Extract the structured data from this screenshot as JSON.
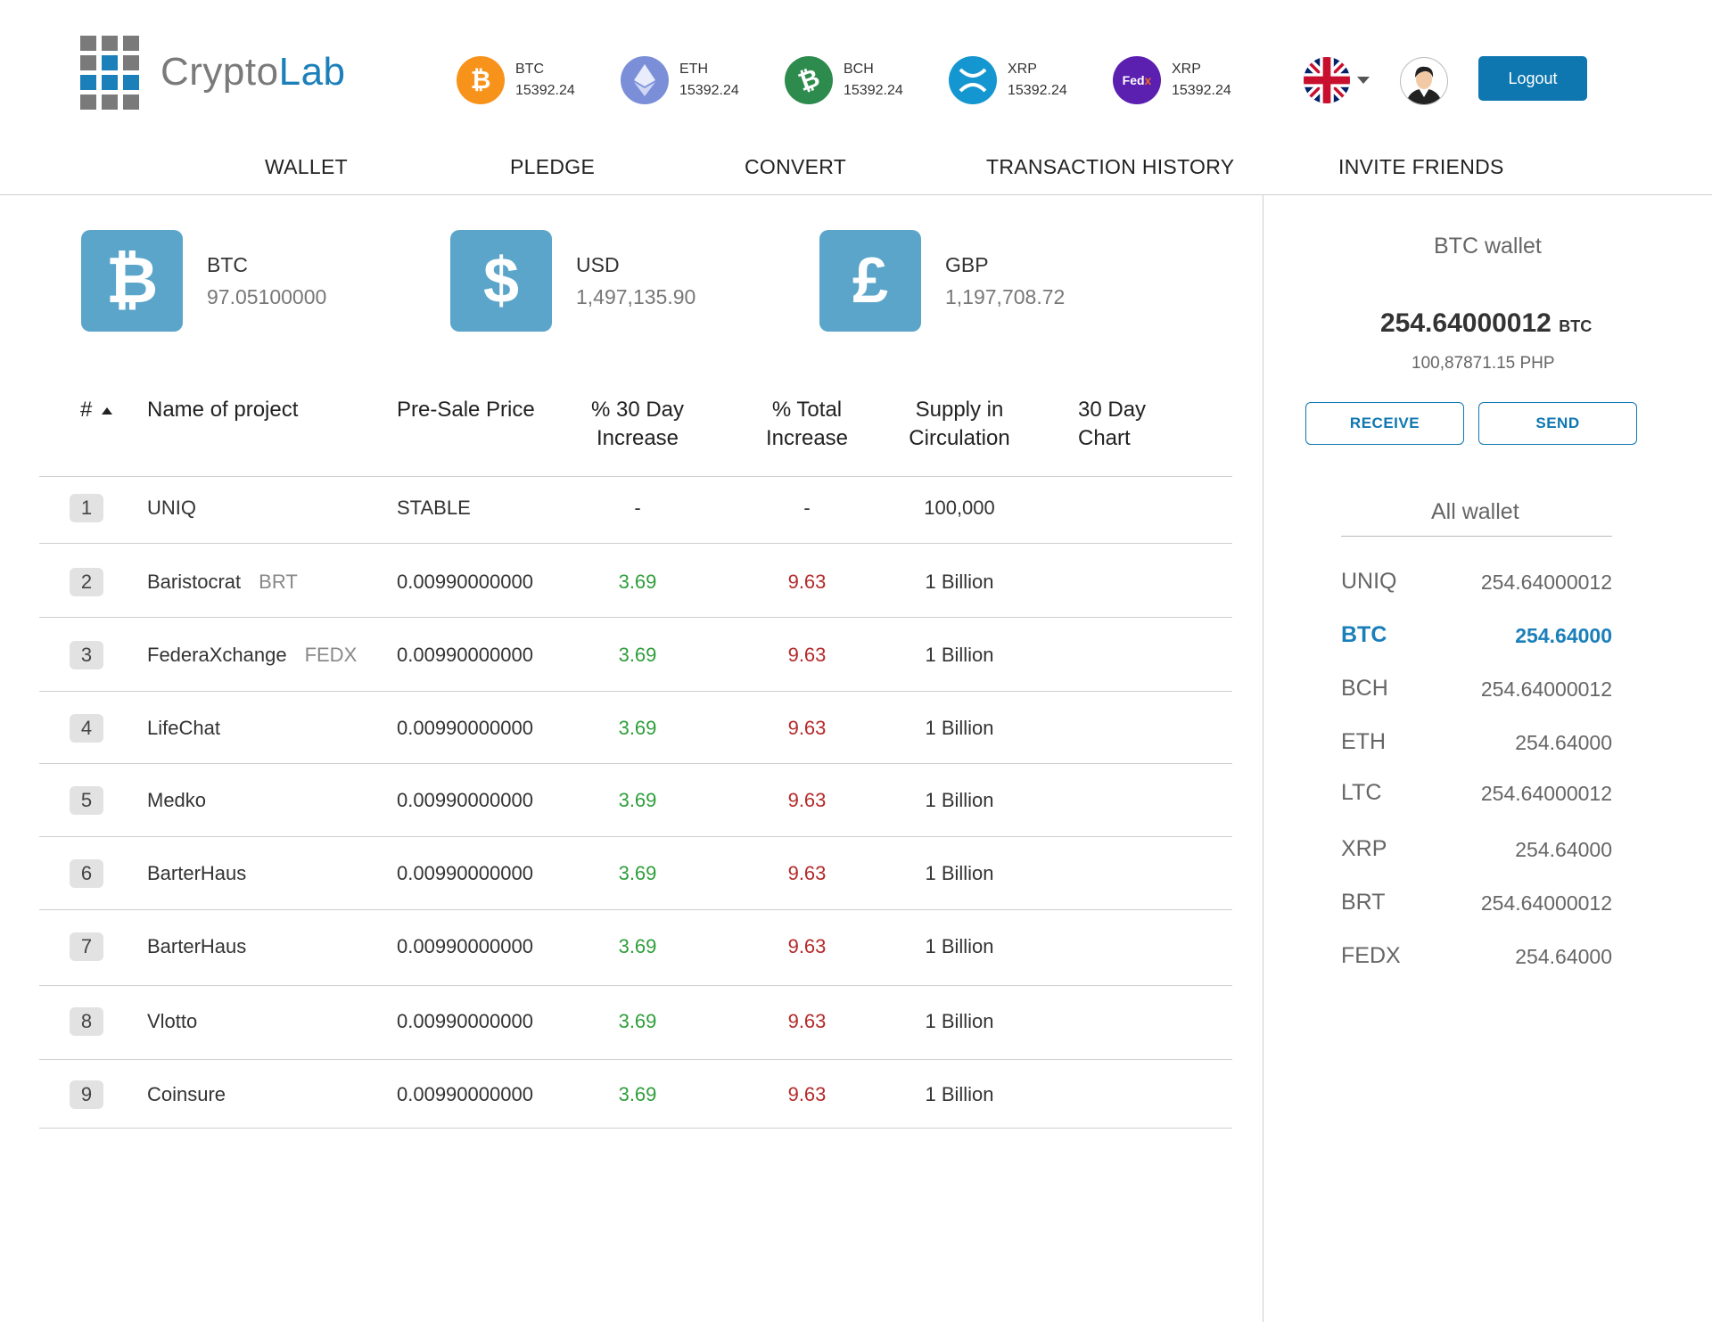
{
  "brand": {
    "part1": "Crypto",
    "part2": "Lab"
  },
  "ticker": [
    {
      "symbol": "BTC",
      "price": "15392.24",
      "icon": "bitcoin-icon",
      "color": "#f7931a",
      "glyph": "₿"
    },
    {
      "symbol": "ETH",
      "price": "15392.24",
      "icon": "ethereum-icon",
      "color": "#7b8fd8",
      "glyph": "◆"
    },
    {
      "symbol": "BCH",
      "price": "15392.24",
      "icon": "bitcoin-cash-icon",
      "color": "#2e8b4e",
      "glyph": "₿"
    },
    {
      "symbol": "XRP",
      "price": "15392.24",
      "icon": "ripple-icon",
      "color": "#1496d0",
      "glyph": "✕"
    },
    {
      "symbol": "XRP",
      "price": "15392.24",
      "icon": "fedx-icon",
      "color": "#5b20b0",
      "glyph": "Fed"
    }
  ],
  "header": {
    "logout": "Logout"
  },
  "nav": [
    "WALLET",
    "PLEDGE",
    "CONVERT",
    "TRANSACTION HISTORY",
    "INVITE FRIENDS"
  ],
  "balances": [
    {
      "code": "BTC",
      "amount": "97.05100000",
      "glyph": "₿"
    },
    {
      "code": "USD",
      "amount": "1,497,135.90",
      "glyph": "$"
    },
    {
      "code": "GBP",
      "amount": "1,197,708.72",
      "glyph": "£"
    }
  ],
  "table": {
    "headers": {
      "num": "#",
      "name": "Name of project",
      "price": "Pre-Sale Price",
      "d30_1": "% 30 Day",
      "d30_2": "Increase",
      "total_1": "% Total",
      "total_2": "Increase",
      "supply_1": "Supply in",
      "supply_2": "Circulation",
      "chart_1": "30 Day",
      "chart_2": "Chart"
    },
    "rows": [
      {
        "n": "1",
        "name": "UNIQ",
        "sym": "",
        "price": "STABLE",
        "d30": "-",
        "total": "-",
        "supply": "100,000"
      },
      {
        "n": "2",
        "name": "Baristocrat",
        "sym": "BRT",
        "price": "0.00990000000",
        "d30": "3.69",
        "total": "9.63",
        "supply": "1 Billion"
      },
      {
        "n": "3",
        "name": "FederaXchange",
        "sym": "FEDX",
        "price": "0.00990000000",
        "d30": "3.69",
        "total": "9.63",
        "supply": "1 Billion"
      },
      {
        "n": "4",
        "name": "LifeChat",
        "sym": "",
        "price": "0.00990000000",
        "d30": "3.69",
        "total": "9.63",
        "supply": "1 Billion"
      },
      {
        "n": "5",
        "name": "Medko",
        "sym": "",
        "price": "0.00990000000",
        "d30": "3.69",
        "total": "9.63",
        "supply": "1 Billion"
      },
      {
        "n": "6",
        "name": "BarterHaus",
        "sym": "",
        "price": "0.00990000000",
        "d30": "3.69",
        "total": "9.63",
        "supply": "1 Billion"
      },
      {
        "n": "7",
        "name": "BarterHaus",
        "sym": "",
        "price": "0.00990000000",
        "d30": "3.69",
        "total": "9.63",
        "supply": "1 Billion"
      },
      {
        "n": "8",
        "name": "Vlotto",
        "sym": "",
        "price": "0.00990000000",
        "d30": "3.69",
        "total": "9.63",
        "supply": "1 Billion"
      },
      {
        "n": "9",
        "name": "Coinsure",
        "sym": "",
        "price": "0.00990000000",
        "d30": "3.69",
        "total": "9.63",
        "supply": "1 Billion"
      }
    ]
  },
  "wallet": {
    "title": "BTC wallet",
    "balance": "254.64000012",
    "unit": "BTC",
    "fiat": "100,87871.15 PHP",
    "receive": "RECEIVE",
    "send": "SEND",
    "all_title": "All wallet",
    "items": [
      {
        "code": "UNIQ",
        "amount": "254.64000012"
      },
      {
        "code": "BTC",
        "amount": "254.64000",
        "active": true
      },
      {
        "code": "BCH",
        "amount": "254.64000012"
      },
      {
        "code": "ETH",
        "amount": "254.64000"
      },
      {
        "code": "LTC",
        "amount": "254.64000012"
      },
      {
        "code": "XRP",
        "amount": "254.64000"
      },
      {
        "code": "BRT",
        "amount": "254.64000012"
      },
      {
        "code": "FEDX",
        "amount": "254.64000"
      }
    ]
  }
}
